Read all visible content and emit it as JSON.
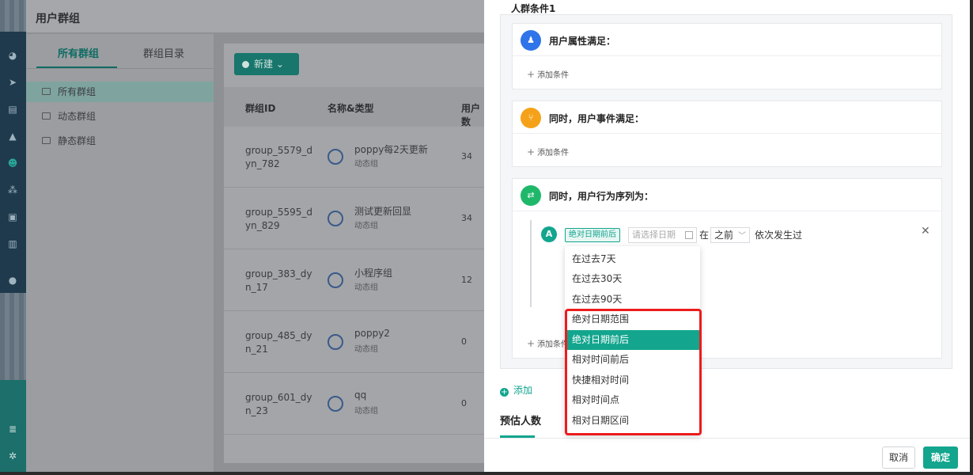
{
  "page": {
    "title": "用户群组",
    "tabs": [
      "所有群组",
      "群组目录"
    ],
    "tree": [
      "所有群组",
      "动态群组",
      "静态群组"
    ],
    "new_button": "新建",
    "table": {
      "headers": [
        "群组ID",
        "名称&类型",
        "用户数"
      ],
      "rows": [
        {
          "id": "group_5579_dyn_782",
          "name": "poppy每2天更新",
          "type": "动态组",
          "count": "34"
        },
        {
          "id": "group_5595_dyn_829",
          "name": "测试更新回显",
          "type": "动态组",
          "count": "34"
        },
        {
          "id": "group_383_dyn_17",
          "name": "小程序组",
          "type": "动态组",
          "count": "12"
        },
        {
          "id": "group_485_dyn_21",
          "name": "poppy2",
          "type": "动态组",
          "count": "0"
        },
        {
          "id": "group_601_dyn_23",
          "name": "qq",
          "type": "动态组",
          "count": "0"
        }
      ]
    }
  },
  "drawer": {
    "condition_title": "人群条件1",
    "cards": [
      {
        "label": "用户属性满足：",
        "add": "添加条件",
        "color": "#2f74e8"
      },
      {
        "label": "同时，用户事件满足：",
        "add": "添加条件",
        "color": "#f5a21a"
      },
      {
        "label": "同时，用户行为序列为：",
        "add": "添加条件",
        "color": "#1fb86a"
      }
    ],
    "sequence": {
      "letter": "A",
      "mode_tag": "绝对日期前后",
      "date_placeholder": "请选择日期",
      "zai": "在",
      "before": "之前",
      "happened": "依次发生过"
    },
    "add_link": "添加",
    "estimate": "预估人数",
    "cancel": "取消",
    "ok": "确定"
  },
  "dropdown": {
    "items": [
      "在过去7天",
      "在过去30天",
      "在过去90天",
      "绝对日期范围",
      "绝对日期前后",
      "相对时间前后",
      "快捷相对时间",
      "相对时间点",
      "相对日期区间"
    ],
    "selected_index": 4
  },
  "colors": {
    "accent": "#13a58e",
    "highlight": "#ec1c1c"
  }
}
